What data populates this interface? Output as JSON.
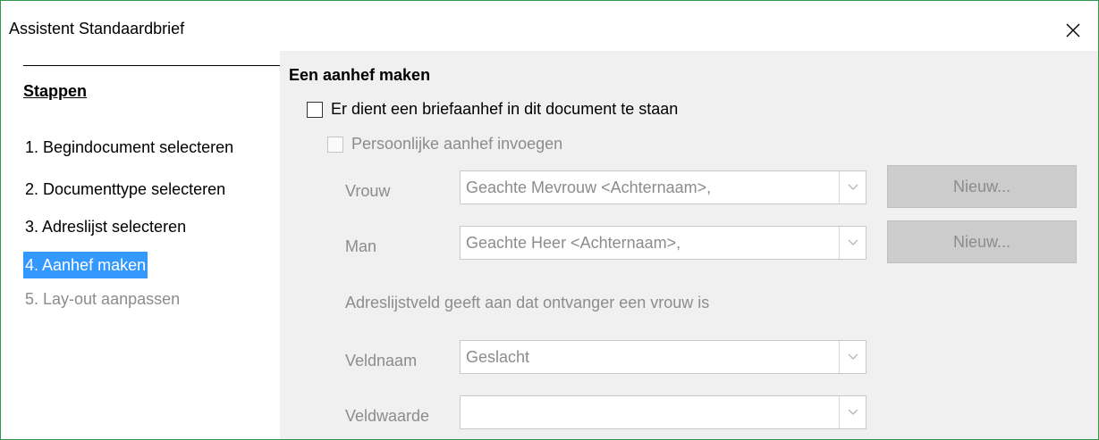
{
  "window": {
    "title": "Assistent Standaardbrief"
  },
  "sidebar": {
    "heading": "Stappen",
    "steps": [
      {
        "label": "1. Begindocument selecteren",
        "state": "normal"
      },
      {
        "label": "2. Documenttype selecteren",
        "state": "normal"
      },
      {
        "label": "3. Adreslijst selecteren",
        "state": "normal"
      },
      {
        "label": "4. Aanhef maken",
        "state": "active"
      },
      {
        "label": "5. Lay-out aanpassen",
        "state": "disabled"
      }
    ]
  },
  "main": {
    "title": "Een aanhef maken",
    "salutation_checkbox": {
      "label": "Er dient een briefaanhef in dit document te staan",
      "checked": false
    },
    "personal_checkbox": {
      "label": "Persoonlijke aanhef invoegen",
      "checked": false,
      "enabled": false
    },
    "female": {
      "label": "Vrouw",
      "value": "Geachte Mevrouw <Achternaam>,",
      "button": "Nieuw..."
    },
    "male": {
      "label": "Man",
      "value": "Geachte Heer <Achternaam>,",
      "button": "Nieuw..."
    },
    "info": "Adreslijstveld geeft aan dat ontvanger een vrouw is",
    "field_name": {
      "label": "Veldnaam",
      "value": "Geslacht"
    },
    "field_value": {
      "label": "Veldwaarde",
      "value": ""
    }
  },
  "colors": {
    "accent": "#3399ff",
    "window_border": "#2e9a4e",
    "disabled_text": "#8c8c8c",
    "panel_bg": "#f0f0f0"
  }
}
